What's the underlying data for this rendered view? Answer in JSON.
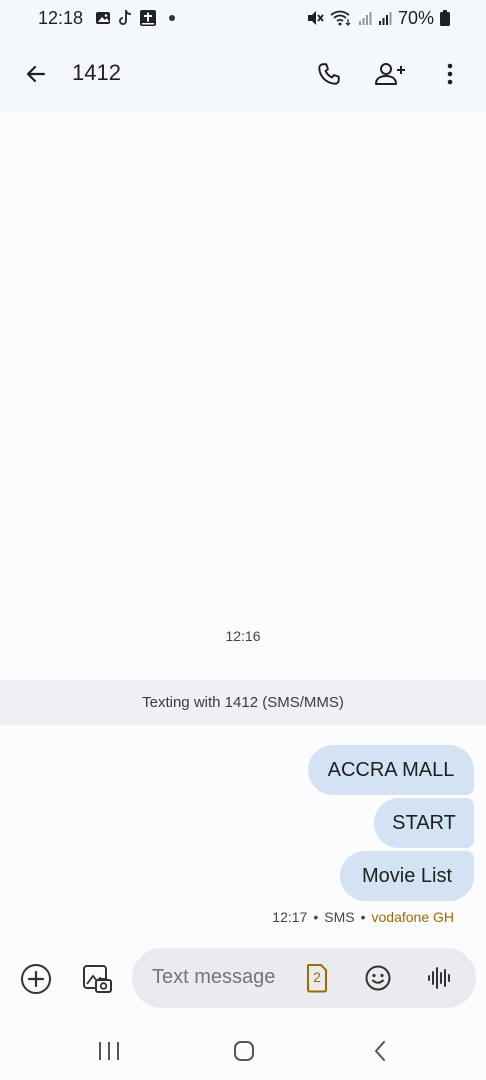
{
  "status_bar": {
    "time": "12:18",
    "battery": "70%",
    "left_icons": [
      "gallery-icon",
      "tiktok-icon",
      "bible-app-icon"
    ],
    "right_icons": [
      "mute-icon",
      "wifi-icon",
      "signal-icon",
      "signal-icon",
      "battery-icon"
    ]
  },
  "app_bar": {
    "title": "1412",
    "actions": [
      "call-icon",
      "add-person-icon",
      "more-vert-icon"
    ]
  },
  "conversation": {
    "day_stamp": "12:16",
    "banner": "Texting with 1412 (SMS/MMS)",
    "messages": [
      {
        "text": "ACCRA MALL"
      },
      {
        "text": "START"
      },
      {
        "text": "Movie List"
      }
    ],
    "meta": {
      "time": "12:17",
      "sep": "•",
      "type": "SMS",
      "carrier": "vodafone GH"
    }
  },
  "compose": {
    "placeholder": "Text message",
    "sim_number": "2"
  },
  "colors": {
    "bubble": "#d3e3f3",
    "header_bg": "#f4f7fc",
    "carrier": "#a06a00",
    "sim_icon": "#a06a00"
  }
}
